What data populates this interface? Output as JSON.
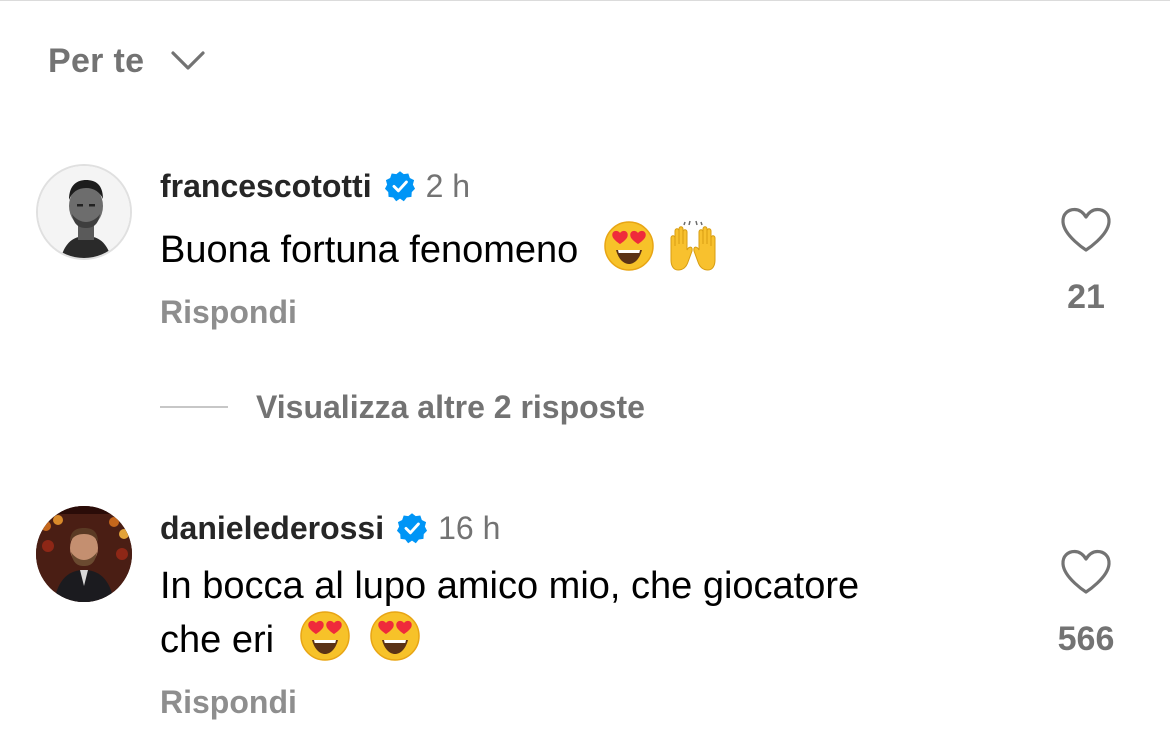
{
  "header": {
    "sort_label": "Per te",
    "sort_icon": "chevron-down-icon"
  },
  "comments": [
    {
      "username": "francescototti",
      "verified": true,
      "time": "2 h",
      "text": "Buona fortuna fenomeno",
      "emojis": [
        "heart-eyes-emoji",
        "raising-hands-emoji"
      ],
      "reply_label": "Rispondi",
      "likes": "21",
      "view_replies_label": "Visualizza altre 2 risposte"
    },
    {
      "username": "danielederossi",
      "verified": true,
      "time": "16 h",
      "text_line1": "In bocca al lupo amico mio, che giocatore",
      "text_line2": "che eri",
      "emojis": [
        "heart-eyes-emoji",
        "heart-eyes-emoji"
      ],
      "reply_label": "Rispondi",
      "likes": "566"
    }
  ],
  "colors": {
    "verified_badge": "#0095f6",
    "secondary_text": "#737373",
    "reply_text": "#8e8e8e",
    "primary_text": "#000000"
  }
}
